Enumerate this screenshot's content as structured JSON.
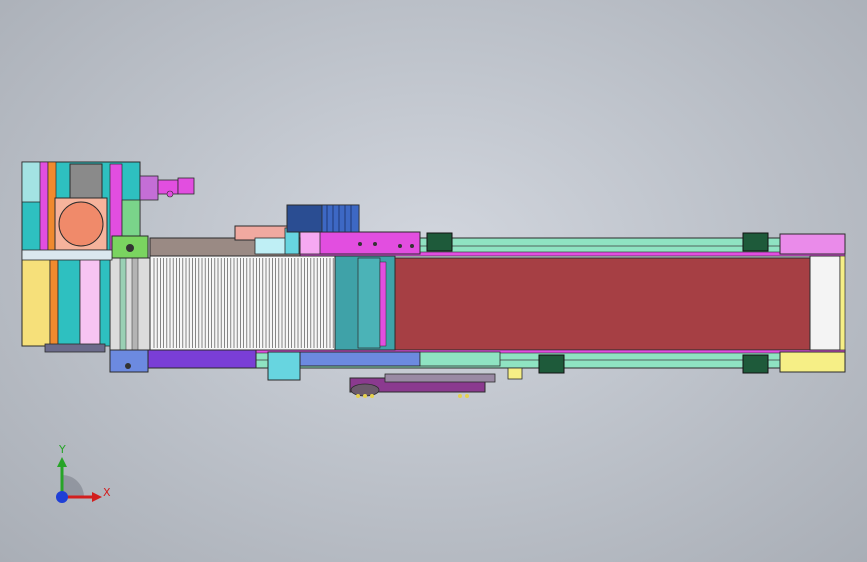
{
  "triad": {
    "y_label": "Y",
    "x_label": "X"
  },
  "colors": {
    "belt": "#a63f44",
    "frame_rail": "#8fe3c2",
    "magenta_part": "#e24ee0",
    "motor_cyan": "#2ec0c0",
    "motor_orange": "#f08a6a",
    "roller_purple": "#7a3ed6",
    "background": "#c2c6cd"
  },
  "icons": [
    "coordinate-triad-icon"
  ]
}
